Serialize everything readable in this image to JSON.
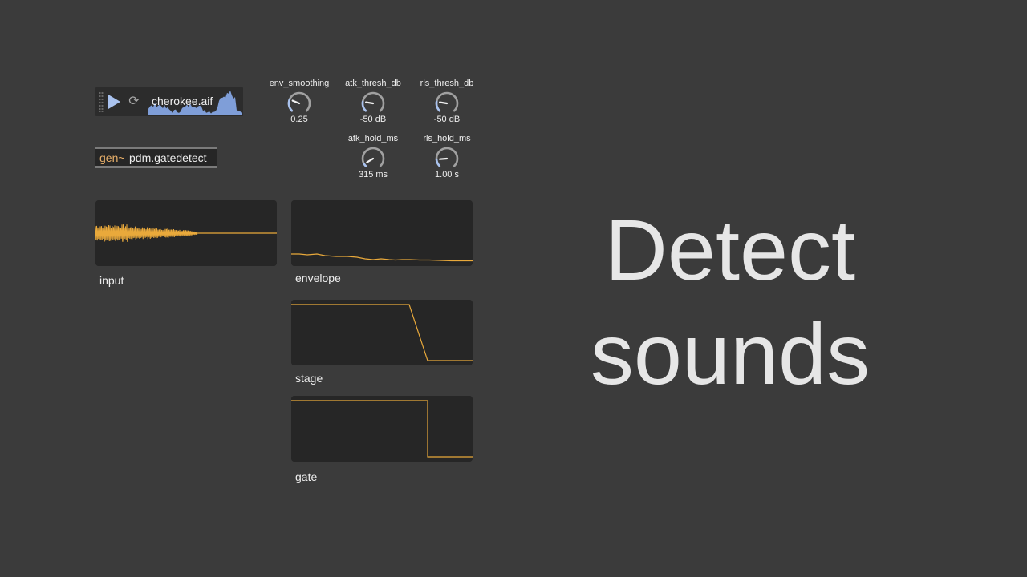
{
  "player": {
    "filename": "cherokee.aif",
    "play_icon": "play-icon",
    "loop_icon": "loop-icon",
    "loop_glyph": "⟳"
  },
  "gen": {
    "keyword": "gen~",
    "argument": "pdm.gatedetect"
  },
  "dials": [
    {
      "name": "env_smoothing",
      "value": "0.25",
      "level": 0.25
    },
    {
      "name": "atk_thresh_db",
      "value": "-50 dB",
      "level": 0.2
    },
    {
      "name": "rls_thresh_db",
      "value": "-50 dB",
      "level": 0.2
    },
    {
      "name": "atk_hold_ms",
      "value": "315 ms",
      "level": 0.05
    },
    {
      "name": "rls_hold_ms",
      "value": "1.00 s",
      "level": 0.15
    }
  ],
  "scopes": {
    "input": "input",
    "envelope": "envelope",
    "stage": "stage",
    "gate": "gate"
  },
  "headline": {
    "line1": "Detect",
    "line2": "sounds"
  },
  "colors": {
    "background": "#3b3b3b",
    "scope_bg": "#262626",
    "trace": "#e9a93b",
    "dial_accent": "#a9c2ee",
    "gen_keyword": "#e9b06a"
  }
}
